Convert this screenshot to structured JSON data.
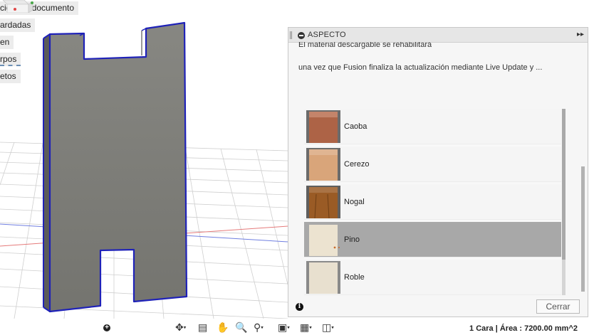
{
  "browser": {
    "items": [
      {
        "label": "ción del documento"
      },
      {
        "label": "ardadas"
      },
      {
        "label": "en"
      },
      {
        "label": "rpos"
      },
      {
        "label": "etos"
      }
    ]
  },
  "panel": {
    "title": "ASPECTO",
    "message_line1": "El material descargable se rehabilitará",
    "message_line2": "una vez que Fusion finaliza la actualización mediante Live Update y ...",
    "materials": [
      {
        "label": "Caoba",
        "color": "#b7694a",
        "selected": false
      },
      {
        "label": "Cerezo",
        "color": "#d9a57a",
        "selected": false
      },
      {
        "label": "Nogal",
        "color": "#9a5b25",
        "selected": false
      },
      {
        "label": "Pino",
        "color": "#ece3d0",
        "selected": true
      },
      {
        "label": "Roble",
        "color": "#e8e0cf",
        "selected": false
      }
    ],
    "close_label": "Cerrar"
  },
  "status": {
    "text": "1 Cara | Área : 7200.00 mm^2"
  },
  "colors": {
    "edge_highlight": "#1f22b8",
    "face": "#7d7d78",
    "selection_row": "#a8a8a8"
  }
}
